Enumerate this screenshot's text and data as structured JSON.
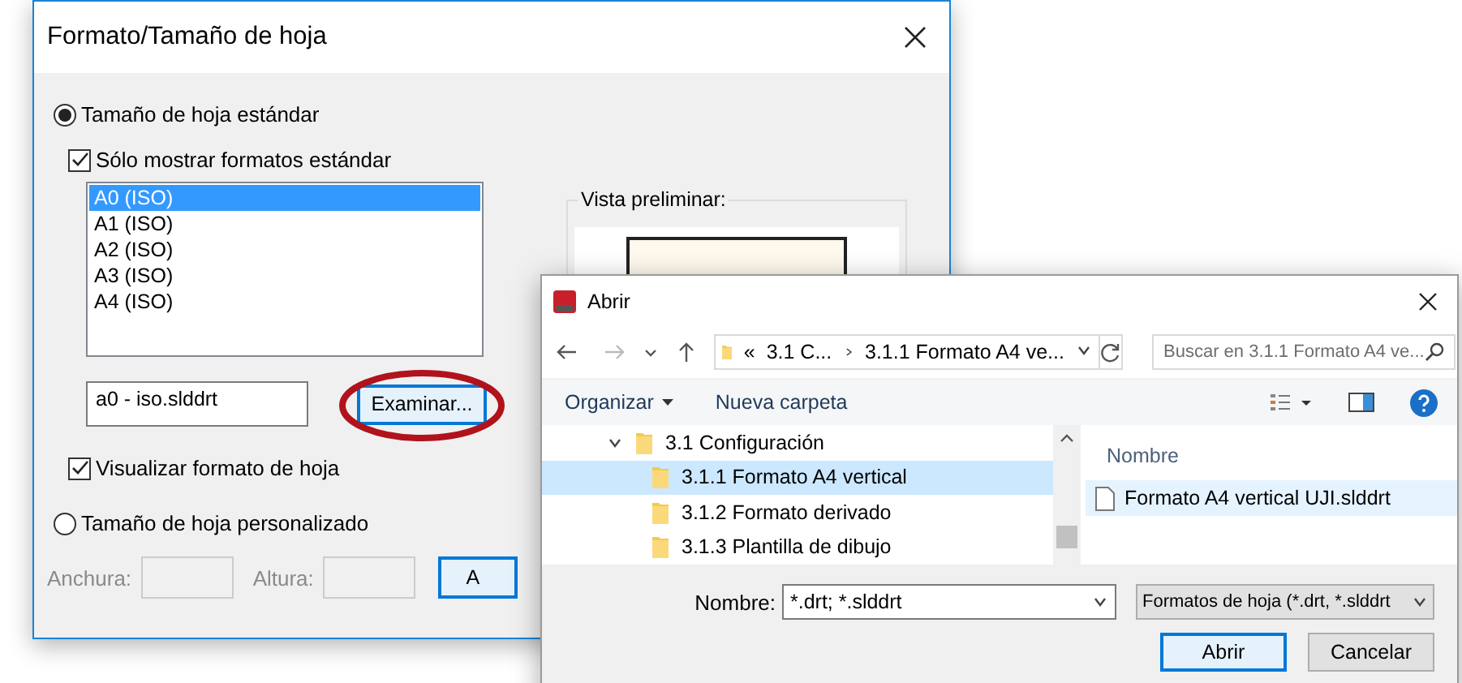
{
  "format_dialog": {
    "title": "Formato/Tamaño de hoja",
    "standard_size": {
      "label": "Tamaño de hoja estándar",
      "selected": true
    },
    "only_standard": {
      "label": "Sólo mostrar formatos estándar",
      "checked": true
    },
    "sizes": [
      {
        "label": "A0 (ISO)",
        "selected": true
      },
      {
        "label": "A1 (ISO)",
        "selected": false
      },
      {
        "label": "A2 (ISO)",
        "selected": false
      },
      {
        "label": "A3 (ISO)",
        "selected": false
      },
      {
        "label": "A4 (ISO)",
        "selected": false
      }
    ],
    "file_field": {
      "value": "a0 - iso.slddrt"
    },
    "browse_button": {
      "label": "Examinar...",
      "circled": true
    },
    "show_format": {
      "label": "Visualizar formato de hoja",
      "checked": true
    },
    "custom_size": {
      "label": "Tamaño de hoja personalizado",
      "selected": false
    },
    "width_field": {
      "label": "Anchura:",
      "disabled": true
    },
    "height_field": {
      "label": "Altura:",
      "disabled": true
    },
    "preview": {
      "label": "Vista preliminar:"
    },
    "partial_button": {
      "label": "A"
    }
  },
  "open_dialog": {
    "title": "Abrir",
    "path": {
      "prefix": "«",
      "parts": [
        "3.1 C...",
        "3.1.1 Formato A4 ve..."
      ]
    },
    "search": {
      "placeholder": "Buscar en 3.1.1 Formato A4 ve..."
    },
    "toolbar": [
      {
        "label": "Organizar",
        "kind": "menu"
      },
      {
        "label": "Nueva carpeta",
        "kind": "button"
      }
    ],
    "tree": [
      {
        "label": "3.1 Configuración",
        "expanded": true,
        "selected": false,
        "children": [
          {
            "label": "3.1.1 Formato A4 vertical",
            "selected": true
          },
          {
            "label": "3.1.2 Formato derivado",
            "selected": false
          },
          {
            "label": "3.1.3 Plantilla de dibujo",
            "selected": false
          }
        ]
      }
    ],
    "files": {
      "column": "Nombre",
      "items": [
        {
          "name": "Formato A4 vertical UJI.slddrt",
          "selected": true
        }
      ]
    },
    "name_field": {
      "label": "Nombre:",
      "value": "*.drt; *.slddrt"
    },
    "type_select": {
      "value": "Formatos de hoja (*.drt, *.slddrt"
    },
    "buttons": [
      {
        "label": "Abrir",
        "default": true
      },
      {
        "label": "Cancelar",
        "default": false
      }
    ]
  }
}
